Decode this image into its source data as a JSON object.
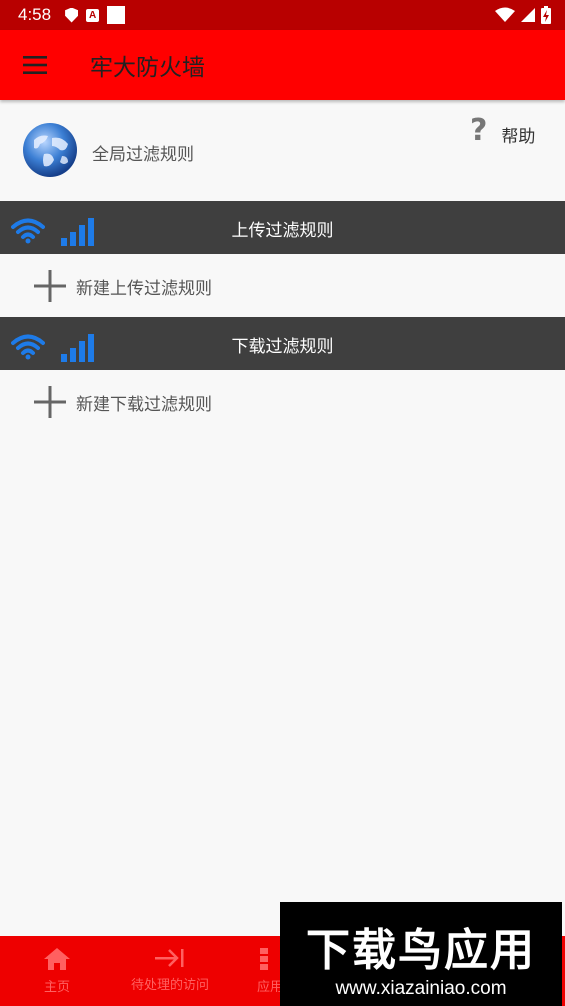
{
  "status_bar": {
    "time": "4:58",
    "badge_a": "A"
  },
  "app_bar": {
    "title": "牢大防火墙"
  },
  "global_rule": {
    "label": "全局过滤规则",
    "help_icon": "?",
    "help_label": "帮助"
  },
  "upload_section": {
    "title": "上传过滤规则",
    "add_label": "新建上传过滤规则"
  },
  "download_section": {
    "title": "下载过滤规则",
    "add_label": "新建下载过滤规则"
  },
  "bottom_nav": {
    "items": [
      {
        "label": "主页",
        "icon": "home-icon"
      },
      {
        "label": "待处理的访问",
        "icon": "arrow-to-line-icon"
      },
      {
        "label": "应用",
        "icon": "grid-icon"
      }
    ]
  },
  "watermark": {
    "title": "下载鸟应用",
    "url": "www.xiazainiao.com"
  },
  "colors": {
    "status_bar": "#b80000",
    "app_bar": "#ff0000",
    "section_header": "#3f3f3f",
    "accent_blue": "#1e7be8",
    "bottom_nav": "#ee0000"
  }
}
